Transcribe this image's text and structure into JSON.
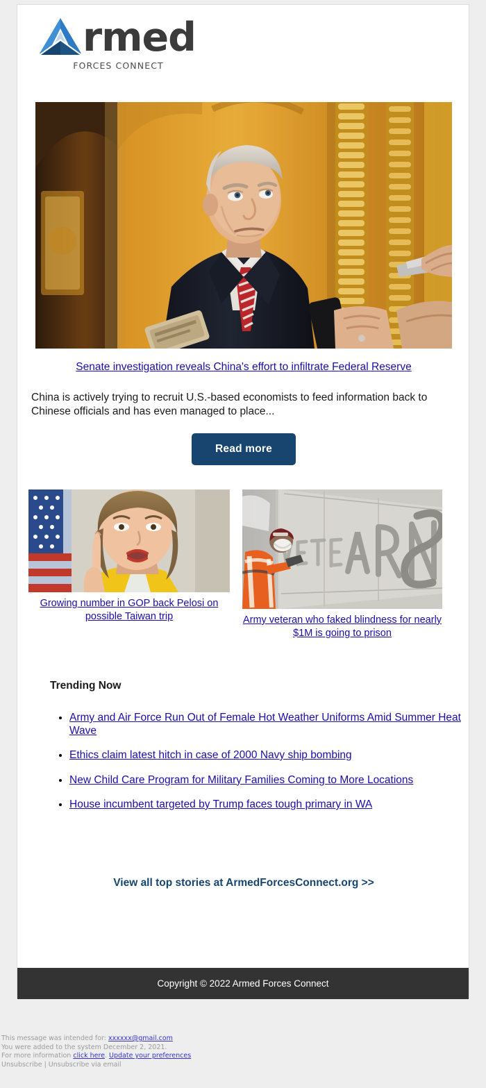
{
  "brand": {
    "word": "rmed",
    "tagline": "FORCES CONNECT",
    "logo_icon": "triangle-a-logo",
    "color_light": "#3a7dc9",
    "color_mid": "#1b5ea8",
    "color_dark": "#15395e"
  },
  "hero": {
    "image_alt": "senator-speaking-to-reporters",
    "headline": "Senate investigation reveals China's effort to infiltrate Federal Reserve",
    "body": "China is actively trying to recruit U.S.-based economists to feed information back to Chinese officials and has even managed to place...",
    "button_label": "Read more",
    "button_color": "#17456f"
  },
  "stories": [
    {
      "image_alt": "nancy-pelosi-at-podium",
      "headline": "Growing number in GOP back Pelosi on possible Taiwan trip"
    },
    {
      "image_alt": "worker-carving-veterans-memorial-wall",
      "headline": "Army veteran who faked blindness for nearly $1M is going to prison"
    }
  ],
  "trending": {
    "title": "Trending Now",
    "items": [
      "Army and Air Force Run Out of Female Hot Weather Uniforms Amid Summer Heat Wave",
      "Ethics claim latest hitch in case of 2000 Navy ship bombing",
      "New Child Care Program for Military Families Coming to More Locations",
      "House incumbent targeted by Trump faces tough primary in WA"
    ]
  },
  "view_all": "View all top stories at ArmedForcesConnect.org >>",
  "copyright": "Copyright © 2022 Armed Forces Connect",
  "fineprint": {
    "intended_prefix": "This message was intended for: ",
    "intended_email": "xxxxxx@gmail.com",
    "added_line": "You were added to the system December 2, 2021.",
    "more_info_prefix": "For more information ",
    "click_here": "click here",
    "period": ". ",
    "update_prefs": "Update your preferences",
    "unsubscribe_line": "Unsubscribe | Unsubscribe via email"
  }
}
